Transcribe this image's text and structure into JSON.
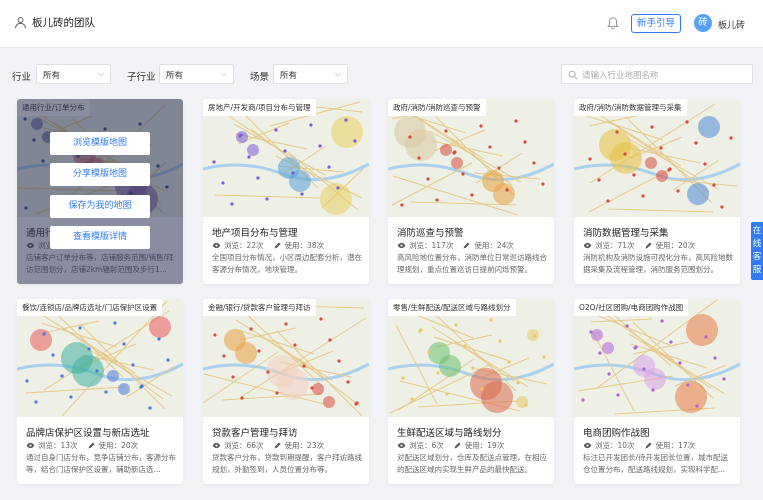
{
  "header": {
    "team_name": "板儿砖的团队",
    "newbie_button": "新手引导",
    "avatar_text": "砖",
    "username": "板儿砖"
  },
  "filters": {
    "industry": {
      "label": "行业",
      "value": "所有"
    },
    "sub_industry": {
      "label": "子行业",
      "value": "所有"
    },
    "scene": {
      "label": "场景",
      "value": "所有"
    },
    "search_placeholder": "请输入行业地图名称"
  },
  "overlay": {
    "browse": "浏览模版地图",
    "share": "分享模版地图",
    "save": "保存为我的地图",
    "details": "查看模版详情"
  },
  "side_tab": "在线客服",
  "cards": [
    {
      "tag": "通用行业/订单分布",
      "title": "通用行业订单分布",
      "views": "浏览：",
      "uses": "使用：",
      "desc": "店铺客户订单分布等，店铺服务范围/销售/拜访范围划分，店铺2km辐射范围及步行1..."
    },
    {
      "tag": "房地产/开发商/项目分布与管理",
      "title": "地产项目分布与管理",
      "views": "浏览：22次",
      "uses": "使用：38次",
      "desc": "全国项目分布情况，小区周边配套分析，潜在客源分布情况，地块管理。"
    },
    {
      "tag": "政府/消防/消防巡查与预警",
      "title": "消防巡查与预警",
      "views": "浏览：117次",
      "uses": "使用：24次",
      "desc": "高风险地位置分布，消防单位日常巡访路线合理规划，重点位置巡访日提前闪烁预警。"
    },
    {
      "tag": "政府/消防/消防数据管理与采集",
      "title": "消防数据管理与采集",
      "views": "浏览：71次",
      "uses": "使用：20次",
      "desc": "消防机构及消防设施可视化分布，高风险地数据采集及流程管理，消防服务范围划分。"
    },
    {
      "tag": "餐饮/连锁店/品牌店选址/门店保护区设置",
      "title": "品牌店保护区设置与新店选址",
      "views": "浏览：13次",
      "uses": "使用：20次",
      "desc": "通过自身门店分布，竞争店铺分布，客源分布等，结合门店保护区设置，辅助新店选..."
    },
    {
      "tag": "金融/银行/贷款客户管理与拜访",
      "title": "贷款客户管理与拜访",
      "views": "浏览：66次",
      "uses": "使用：23次",
      "desc": "贷款客户分布，贷款到期提醒，客户拜访路线规划，外勤签到，人员位置分布等。"
    },
    {
      "tag": "零售/生鲜配送/配送区域与路线划分",
      "title": "生鲜配送区域与路线划分",
      "views": "浏览：6次",
      "uses": "使用：19次",
      "desc": "对配送区域划分，仓库及配送点管理，在相应的配送区域内实现生鲜产品的最快配送。"
    },
    {
      "tag": "O2O/社区团购/电商团购作战图",
      "title": "电商团购作战图",
      "views": "浏览：10次",
      "uses": "使用：17次",
      "desc": "标注已开发团长/待开发团长位置，城市配送仓位置分布，配送路线规划，实现科学配..."
    }
  ]
}
